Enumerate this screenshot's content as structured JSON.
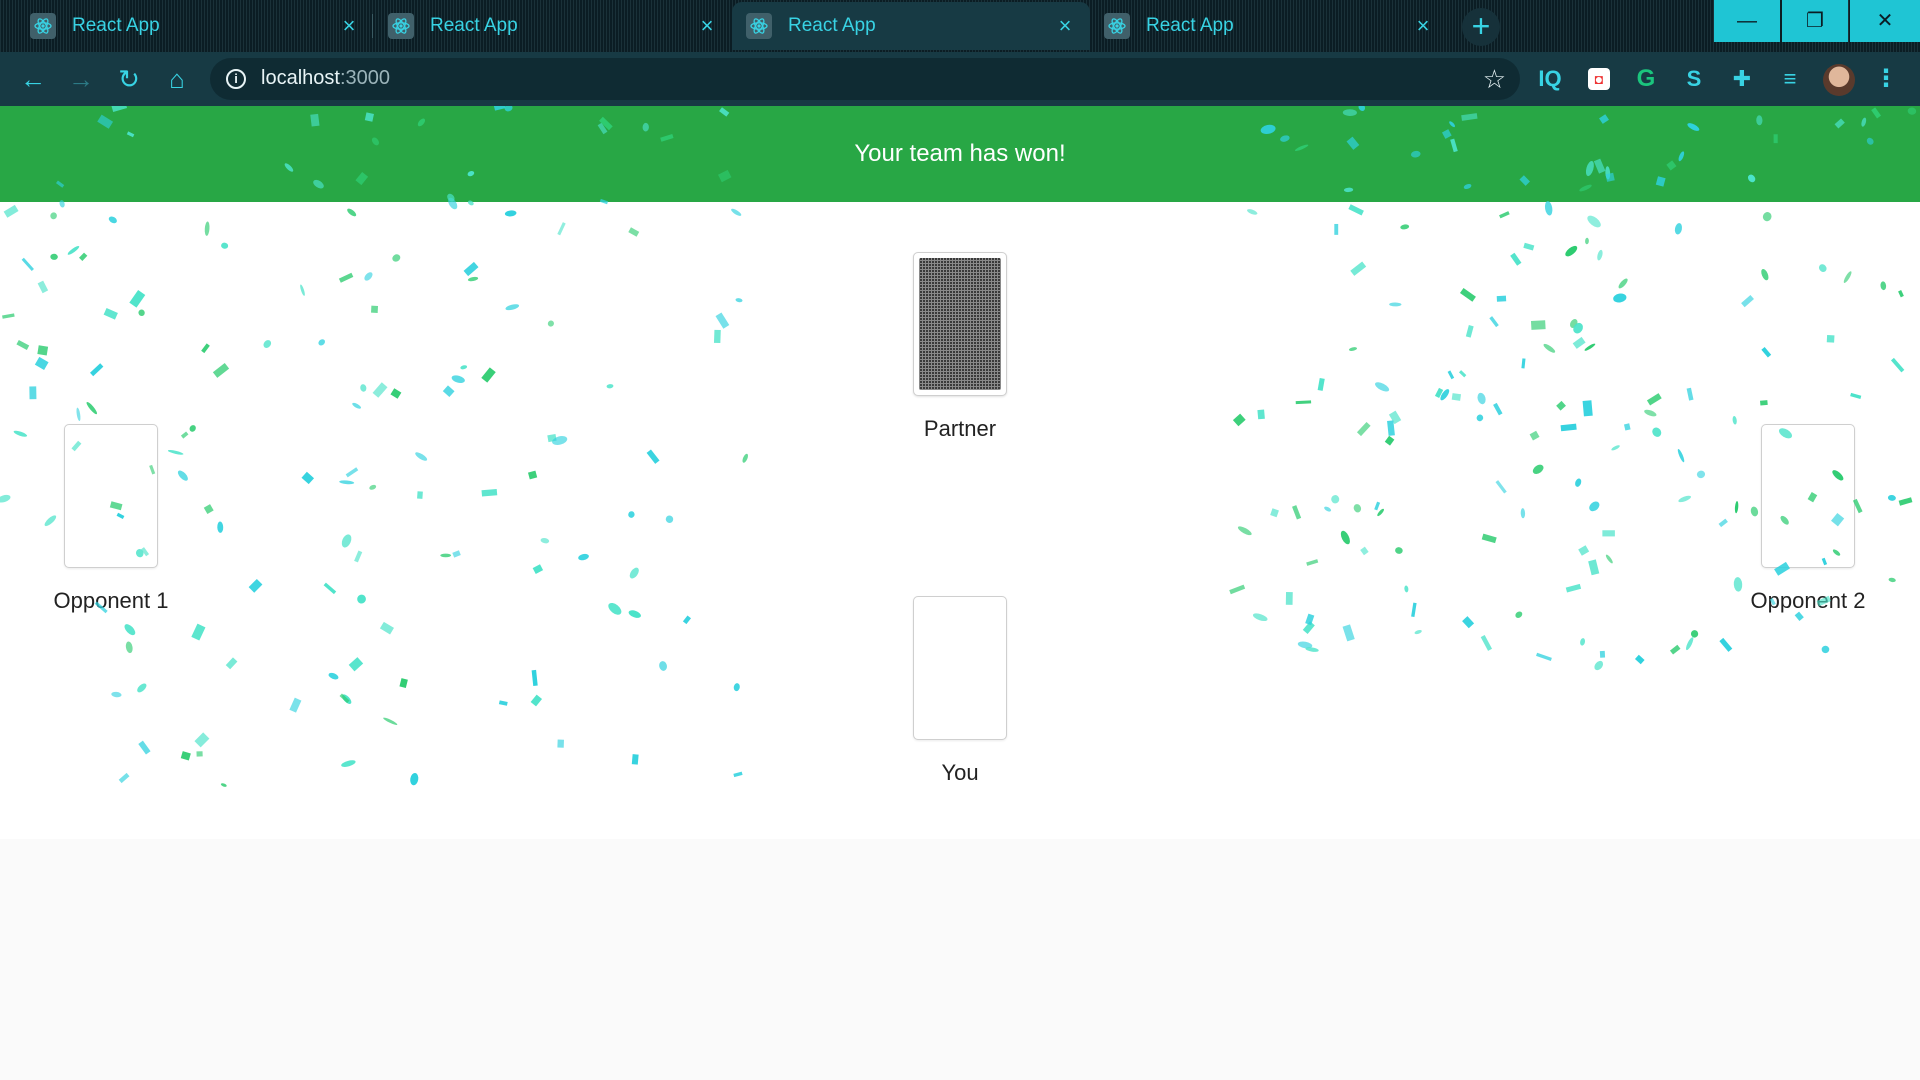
{
  "browser": {
    "tabs": [
      {
        "title": "React App",
        "active": false
      },
      {
        "title": "React App",
        "active": false
      },
      {
        "title": "React App",
        "active": true
      },
      {
        "title": "React App",
        "active": false
      }
    ],
    "address": {
      "host": "localhost",
      "port": ":3000"
    },
    "accent": "#38d3e4"
  },
  "game": {
    "banner": "Your team has won!",
    "banner_color": "#28a745",
    "players": {
      "partner": "Partner",
      "opponent1": "Opponent 1",
      "opponent2": "Opponent 2",
      "you": "You"
    }
  },
  "confetti_colors": [
    "#2fd1de",
    "#2ecc71",
    "#4be3c9"
  ]
}
